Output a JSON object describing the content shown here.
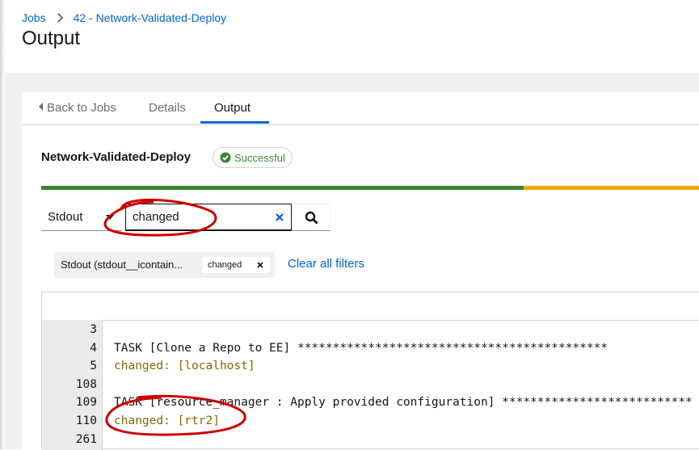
{
  "breadcrumb": {
    "jobs": "Jobs",
    "job": "42 - Network-Validated-Deploy"
  },
  "page_title": "Output",
  "tabs": {
    "back": "Back to Jobs",
    "details": "Details",
    "output": "Output"
  },
  "job": {
    "name": "Network-Validated-Deploy",
    "status": "Successful"
  },
  "progress": {
    "ok_fraction": 0.733,
    "changed_fraction": 0.267,
    "ok_color": "#3e8635",
    "changed_color": "#f0ab00"
  },
  "search": {
    "type": "Stdout",
    "value": "changed"
  },
  "filters": {
    "label": "Stdout (stdout__icontain...",
    "chip": "changed",
    "clear_all": "Clear all filters"
  },
  "output": {
    "lines": [
      {
        "num": "3",
        "text": ""
      },
      {
        "num": "4",
        "text": "TASK [Clone a Repo to EE] ********************************************"
      },
      {
        "num": "5",
        "text": "changed: [localhost]",
        "changed": true
      },
      {
        "num": "108",
        "text": ""
      },
      {
        "num": "109",
        "text": "TASK [resource_manager : Apply provided configuration] ***************************"
      },
      {
        "num": "110",
        "text": "changed: [rtr2]",
        "changed": true
      },
      {
        "num": "261",
        "text": ""
      }
    ]
  },
  "colors": {
    "link": "#0066cc",
    "success": "#3e8635",
    "changed_text": "#7f6a00",
    "annotation": "#cc0000"
  }
}
